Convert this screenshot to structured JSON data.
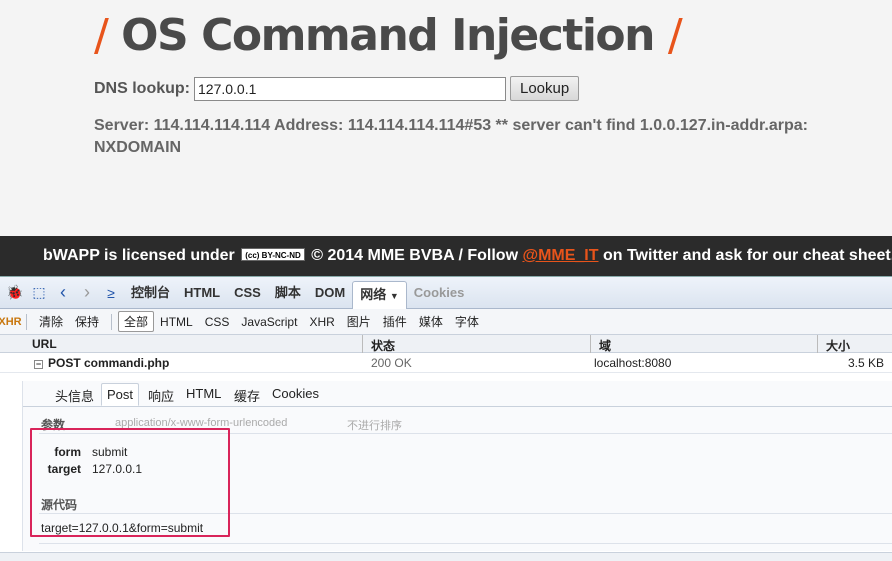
{
  "page": {
    "title_slash_left": "/",
    "title": "OS Command Injection",
    "title_slash_right": "/",
    "dns_label": "DNS lookup:",
    "dns_value": "127.0.0.1",
    "lookup_button": "Lookup",
    "result": "Server: 114.114.114.114 Address: 114.114.114.114#53 ** server can't find 1.0.0.127.in-addr.arpa: NXDOMAIN"
  },
  "footer": {
    "text_before": "bWAPP is licensed under",
    "cc_badge": "(cc) BY-NC-ND",
    "text_middle": "© 2014 MME BVBA / Follow",
    "twitter": "@MME_IT",
    "text_after": "on Twitter and ask for our cheat sheet, containing"
  },
  "firebug": {
    "main_tabs": [
      "控制台",
      "HTML",
      "CSS",
      "脚本",
      "DOM",
      "网络",
      "Cookies"
    ],
    "active_tab": "网络",
    "filter_buttons": [
      "清除",
      "保持",
      "全部",
      "HTML",
      "CSS",
      "JavaScript",
      "XHR",
      "图片",
      "插件",
      "媒体",
      "字体"
    ],
    "active_filter": "全部",
    "columns": {
      "url": "URL",
      "status": "状态",
      "domain": "域",
      "size": "大小"
    },
    "request": {
      "method_url": "POST commandi.php",
      "status": "200 OK",
      "domain": "localhost:8080",
      "size": "3.5 KB"
    },
    "detail_tabs": [
      "头信息",
      "Post",
      "响应",
      "HTML",
      "缓存",
      "Cookies"
    ],
    "active_detail_tab": "Post",
    "params_heading": "参数",
    "encoding": "application/x-www-form-urlencoded",
    "sort_label": "不进行排序",
    "params": [
      {
        "name": "form",
        "value": "submit"
      },
      {
        "name": "target",
        "value": "127.0.0.1"
      }
    ],
    "source_heading": "源代码",
    "source": "target=127.0.0.1&form=submit"
  },
  "colors": {
    "accent": "#e8541b",
    "highlight_box": "#d9245a",
    "footer_bg": "#2b2b2b"
  }
}
